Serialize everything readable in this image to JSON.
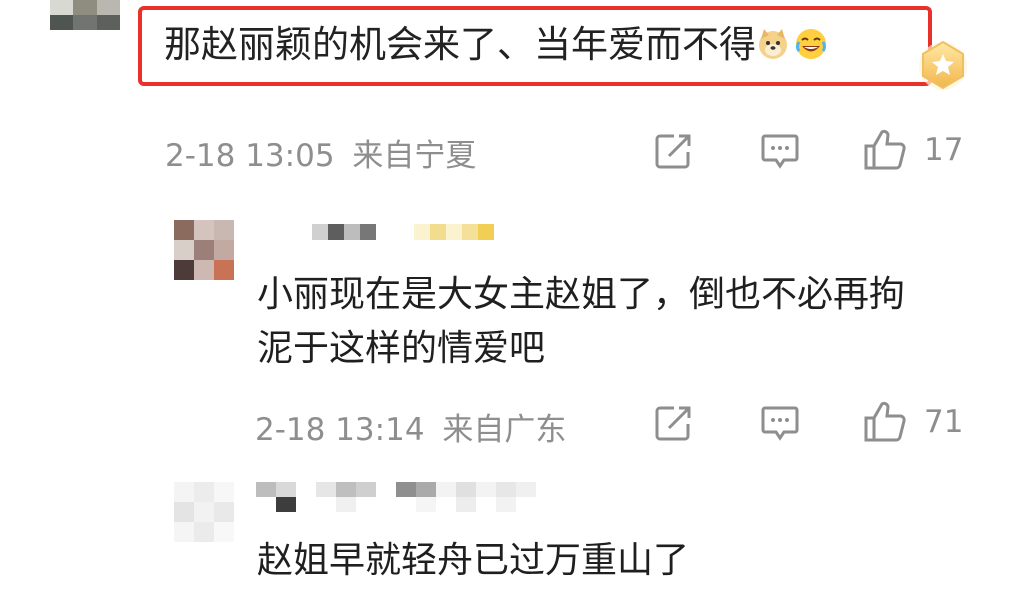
{
  "comments": [
    {
      "text": "那赵丽颖的机会来了、当年爱而不得",
      "emojis": [
        "doge-icon",
        "laugh-cry-icon"
      ],
      "timestamp": "2-18 13:05",
      "location": "来自宁夏",
      "likes": "17"
    },
    {
      "text": "小丽现在是大女主赵姐了，倒也不必再拘泥于这样的情爱吧",
      "timestamp": "2-18 13:14",
      "location": "来自广东",
      "likes": "71"
    },
    {
      "text": "赵姐早就轻舟已过万重山了"
    }
  ],
  "icons": {
    "share": "share-icon",
    "comment": "comment-icon",
    "like": "thumbs-up-icon",
    "badge": "gold-badge-icon"
  },
  "colors": {
    "highlight_border": "#e8312b",
    "meta_text": "#8e8e8e",
    "body_text": "#222222"
  }
}
